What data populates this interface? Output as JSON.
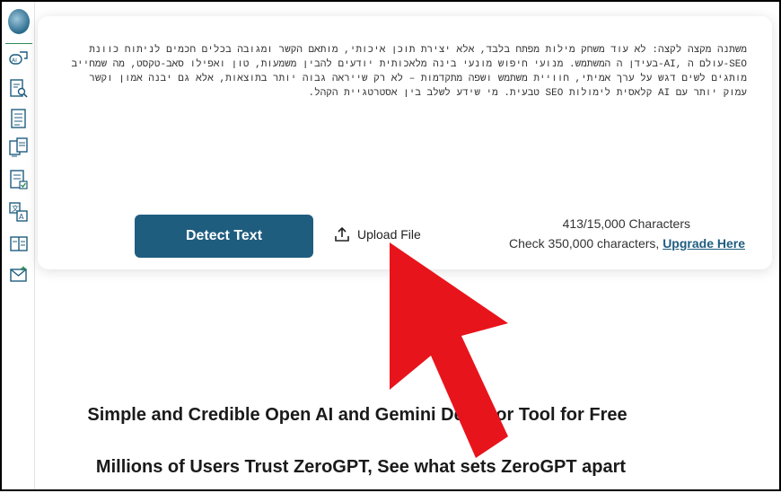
{
  "sidebar": {
    "icons": [
      "brain-logo-icon",
      "ai-chat-icon",
      "document-search-icon",
      "document-list-icon",
      "document-compare-icon",
      "document-check-icon",
      "translate-icon",
      "book-icon",
      "email-icon"
    ]
  },
  "editor": {
    "text": "משתנה מקצה לקצה: לא עוד משחק מילות מפתח בלבד, אלא יצירת תוכן איכותי, מותאם הקשר ומגובה בכלים חכמים לניתוח כוונת SEO-עולם ה ,AI-בעידן ה המשתמש. מנועי חיפוש מונעי בינה מלאכותית יודעים להבין משמעות, טון ואפילו סאב-טקסט, מה שמחייב מותגים לשים דגש על ערך אמיתי, חוויית משתמש ושפה מתקדמות – לא רק שייראה גבוה יותר בתוצאות, אלא גם יבנה אמון וקשר עמוק יותר עם AI קלאסית לימולות SEO טבעית. מי שידע לשלב בין אסטרטגיית הקהל."
  },
  "actions": {
    "detect_label": "Detect Text",
    "upload_label": "Upload File"
  },
  "stats": {
    "char_count": "413/15,000 Characters",
    "check_text": "Check 350,000 characters, ",
    "upgrade_label": "Upgrade Here"
  },
  "headlines": {
    "line1": "Simple and Credible Open AI and Gemini Detector Tool for Free",
    "line2": "Millions of Users Trust ZeroGPT, See what sets ZeroGPT apart"
  },
  "colors": {
    "accent": "#1f5d7f",
    "annotation_arrow": "#e8141c"
  }
}
